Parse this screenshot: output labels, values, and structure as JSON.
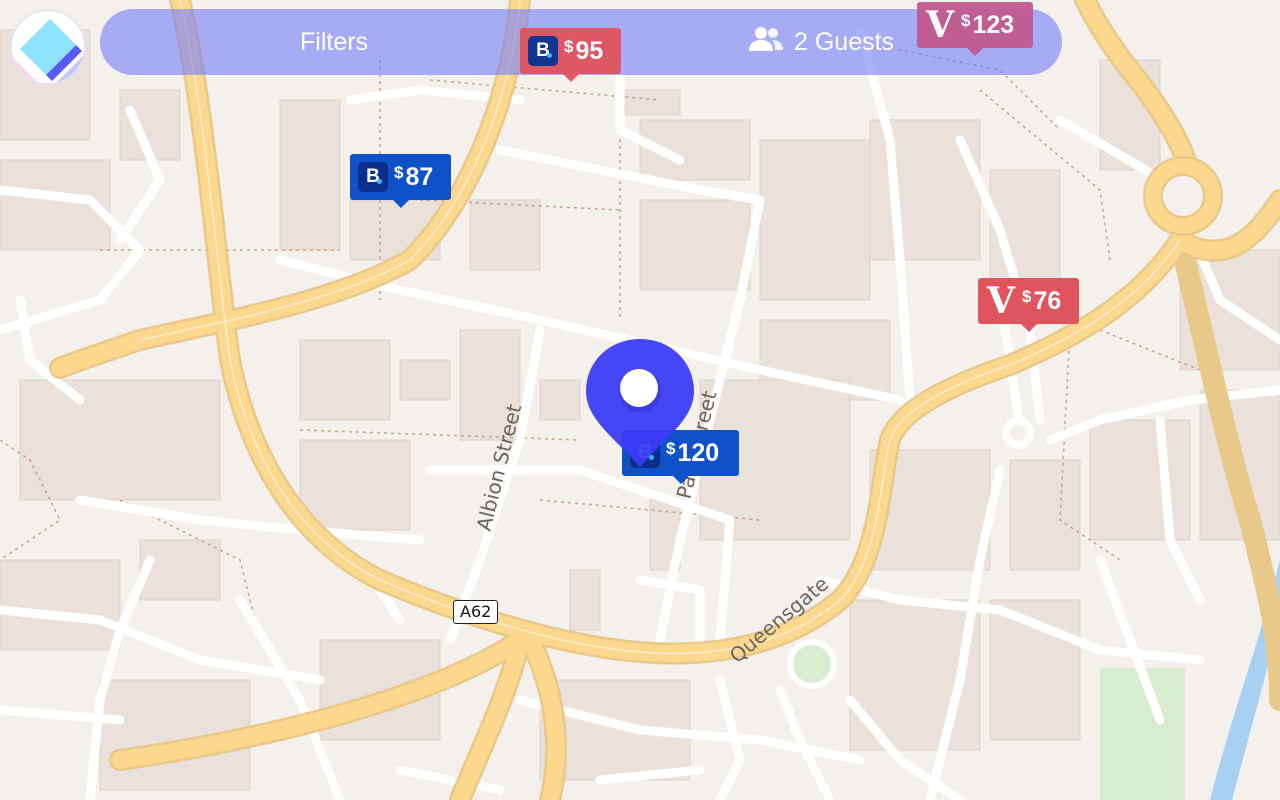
{
  "header": {
    "filters_label": "Filters",
    "guests_label": "2 Guests",
    "guests_icon": "people-icon",
    "logo_icon": "app-logo-icon"
  },
  "map": {
    "road_labels": {
      "albion_street": "Albion Street",
      "park_street": "Park Street",
      "queensgate": "Queensgate"
    },
    "shield_label": "A62",
    "location_pin_icon": "location-pin-icon"
  },
  "markers": [
    {
      "provider": "booking",
      "icon": "booking-b-icon",
      "currency": "$",
      "price": "95",
      "color": "#e0545e"
    },
    {
      "provider": "booking",
      "icon": "booking-b-icon",
      "currency": "$",
      "price": "87",
      "color": "#0f52c8"
    },
    {
      "provider": "vrbo",
      "icon": "vrbo-v-icon",
      "currency": "$",
      "price": "123",
      "color": "#c05a8e"
    },
    {
      "provider": "vrbo",
      "icon": "vrbo-v-icon",
      "currency": "$",
      "price": "76",
      "color": "#e0545e"
    },
    {
      "provider": "booking",
      "icon": "booking-b-icon",
      "currency": "$",
      "price": "120",
      "color": "#0f52c8"
    }
  ],
  "colors": {
    "accent": "#3b3cf5",
    "topbar": "#7880f8",
    "booking": "#0f52c8",
    "vrbo": "#e0545e"
  }
}
